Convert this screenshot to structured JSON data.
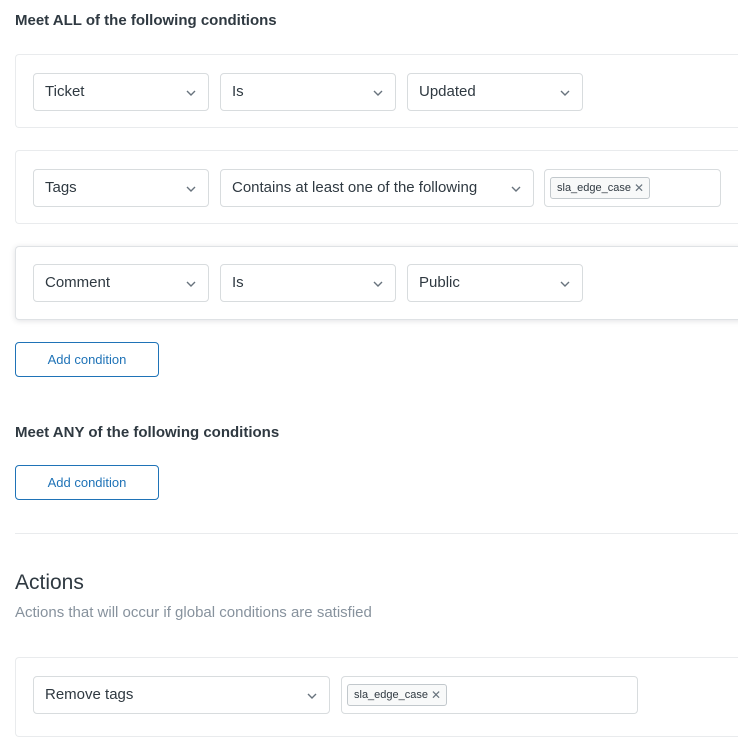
{
  "all_conditions": {
    "title": "Meet ALL of the following conditions",
    "rows": [
      {
        "field": "Ticket",
        "operator": "Is",
        "value": "Updated"
      },
      {
        "field": "Tags",
        "operator": "Contains at least one of the following",
        "tag": "sla_edge_case"
      },
      {
        "field": "Comment",
        "operator": "Is",
        "value": "Public"
      }
    ],
    "add_label": "Add condition"
  },
  "any_conditions": {
    "title": "Meet ANY of the following conditions",
    "add_label": "Add condition"
  },
  "actions": {
    "title": "Actions",
    "subtitle": "Actions that will occur if global conditions are satisfied",
    "rows": [
      {
        "action": "Remove tags",
        "tag": "sla_edge_case"
      }
    ]
  },
  "colors": {
    "accent": "#1f73b7",
    "text": "#2f3941",
    "muted": "#87929d",
    "border": "#d8dcde"
  },
  "icons": {
    "dropdown": "chevron-down-icon",
    "remove_tag": "close-icon"
  }
}
